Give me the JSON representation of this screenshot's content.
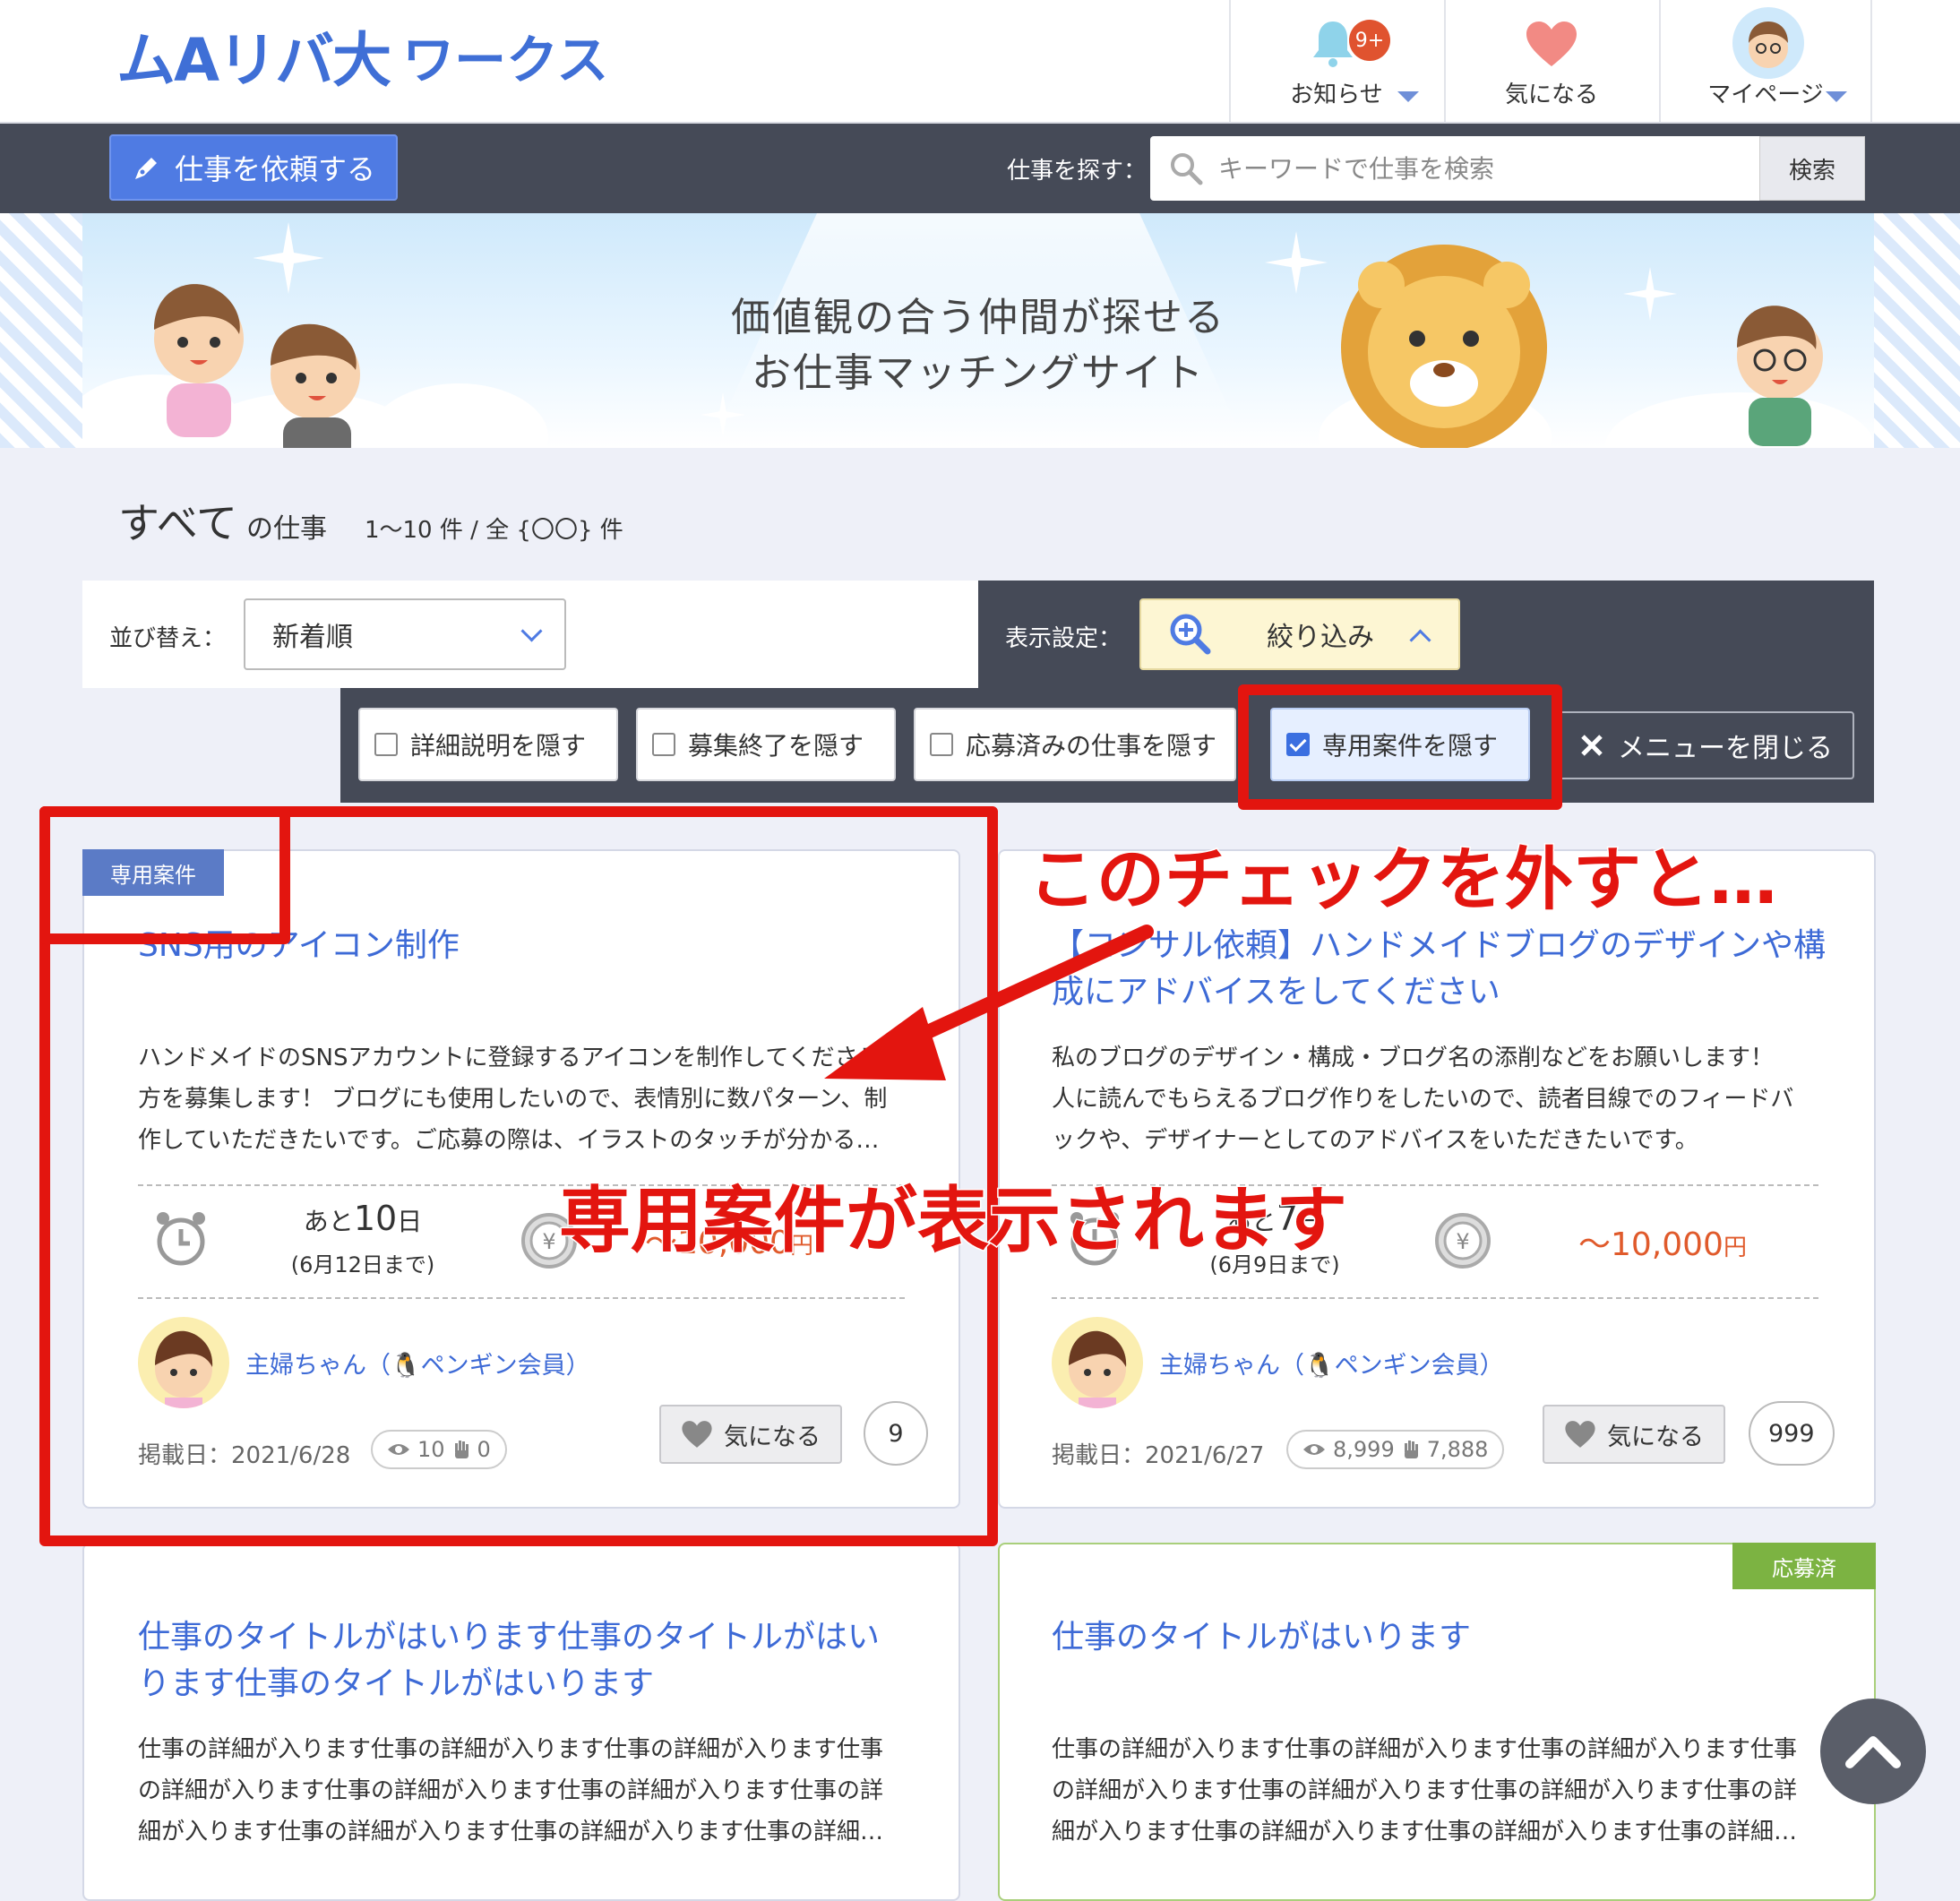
{
  "header": {
    "logo_mark": "ムAリバ大",
    "logo_word": "ワークス",
    "nav": [
      {
        "label": "お知らせ",
        "badge": "9+"
      },
      {
        "label": "気になる"
      },
      {
        "label": "マイページ"
      }
    ]
  },
  "toolbar": {
    "order_button": "仕事を依頼する",
    "search_label": "仕事を探す：",
    "search_placeholder": "キーワードで仕事を検索",
    "search_button": "検索"
  },
  "banner": {
    "line1": "価値観の合う仲間が探せる",
    "line2": "お仕事マッチングサイト"
  },
  "listing": {
    "title_big": "すべて",
    "title_small": "の仕事",
    "count": "1〜10 件 / 全 {〇〇} 件"
  },
  "controls": {
    "sort_label": "並び替え：",
    "sort_value": "新着順",
    "display_label": "表示設定：",
    "filter_button": "絞り込み",
    "options": [
      {
        "label": "詳細説明を隠す",
        "checked": false
      },
      {
        "label": "募集終了を隠す",
        "checked": false
      },
      {
        "label": "応募済みの仕事を隠す",
        "checked": false
      },
      {
        "label": "専用案件を隠す",
        "checked": true
      }
    ],
    "close_menu": "メニューを閉じる"
  },
  "cards": [
    {
      "tag": "専用案件",
      "title": "SNS用のアイコン制作",
      "desc": [
        "ハンドメイドのSNSアカウントに登録するアイコンを制作してくださる",
        "方を募集します！ ブログにも使用したいので、表情別に数パターン、制",
        "作していただきたいです。ご応募の際は、イラストのタッチが分かる…"
      ],
      "deadline_prefix": "あと",
      "deadline_days": "10",
      "deadline_suffix": "日",
      "deadline_sub": "(6月12日まで)",
      "price": "〜10,000",
      "price_unit": "円",
      "poster": "主婦ちゃん（🐧ペンギン会員）",
      "date": "掲載日：2021/6/28",
      "views": "10",
      "applies": "0",
      "fav_label": "気になる",
      "fav_count": "9"
    },
    {
      "title": "【コンサル依頼】ハンドメイドブログのデザインや構成にアドバイスをしてください",
      "desc": [
        "私のブログのデザイン・構成・ブログ名の添削などをお願いします！",
        "人に読んでもらえるブログ作りをしたいので、読者目線でのフィードバ",
        "ックや、デザイナーとしてのアドバイスをいただきたいです。"
      ],
      "deadline_prefix": "あと",
      "deadline_days": "7",
      "deadline_suffix": "日",
      "deadline_sub": "(6月9日まで)",
      "price": "〜10,000",
      "price_unit": "円",
      "poster": "主婦ちゃん（🐧ペンギン会員）",
      "date": "掲載日：2021/6/27",
      "views": "8,999",
      "applies": "7,888",
      "fav_label": "気になる",
      "fav_count": "999"
    },
    {
      "title": "仕事のタイトルがはいります仕事のタイトルがはいります仕事のタイトルがはいります",
      "desc": [
        "仕事の詳細が入ります仕事の詳細が入ります仕事の詳細が入ります仕事",
        "の詳細が入ります仕事の詳細が入ります仕事の詳細が入ります仕事の詳",
        "細が入ります仕事の詳細が入ります仕事の詳細が入ります仕事の詳細…"
      ]
    },
    {
      "tag": "応募済",
      "title": "仕事のタイトルがはいります",
      "desc": [
        "仕事の詳細が入ります仕事の詳細が入ります仕事の詳細が入ります仕事",
        "の詳細が入ります仕事の詳細が入ります仕事の詳細が入ります仕事の詳",
        "細が入ります仕事の詳細が入ります仕事の詳細が入ります仕事の詳細…"
      ]
    }
  ],
  "annotations": {
    "text1": "このチェックを外すと…",
    "text2": "専用案件が表示されます"
  },
  "colors": {
    "accent": "#3d6ad6",
    "toolbar": "#454a57",
    "annotation": "#e3150f",
    "applied_tag": "#7cb342"
  }
}
